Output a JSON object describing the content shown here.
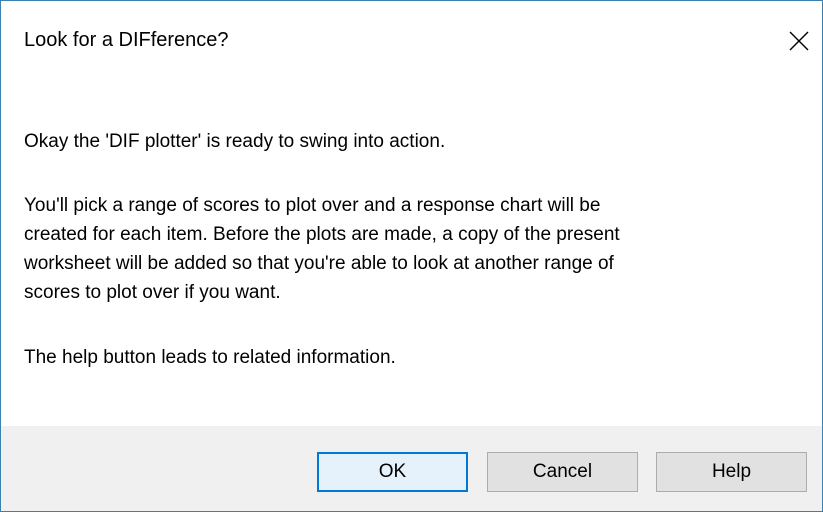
{
  "dialog": {
    "title": "Look for a DIFference?",
    "close_icon": "close-icon",
    "message_lines_1": [
      "Okay the 'DIF plotter' is ready to swing into action."
    ],
    "message_lines_2": [
      "You'll pick a range of scores to plot over and a response chart will be",
      "created for each item. Before the plots are made, a copy of the present",
      "worksheet will be added so that you're able to look at another range of",
      "scores to plot over if you want."
    ],
    "message_lines_3": [
      "The help button leads to related information."
    ]
  },
  "buttons": {
    "ok_label": "OK",
    "cancel_label": "Cancel",
    "help_label": "Help"
  },
  "colors": {
    "accent": "#0078d7",
    "window_border": "#3c7fb1",
    "footer_bg": "#f0f0f0",
    "button_bg": "#e1e1e1"
  }
}
